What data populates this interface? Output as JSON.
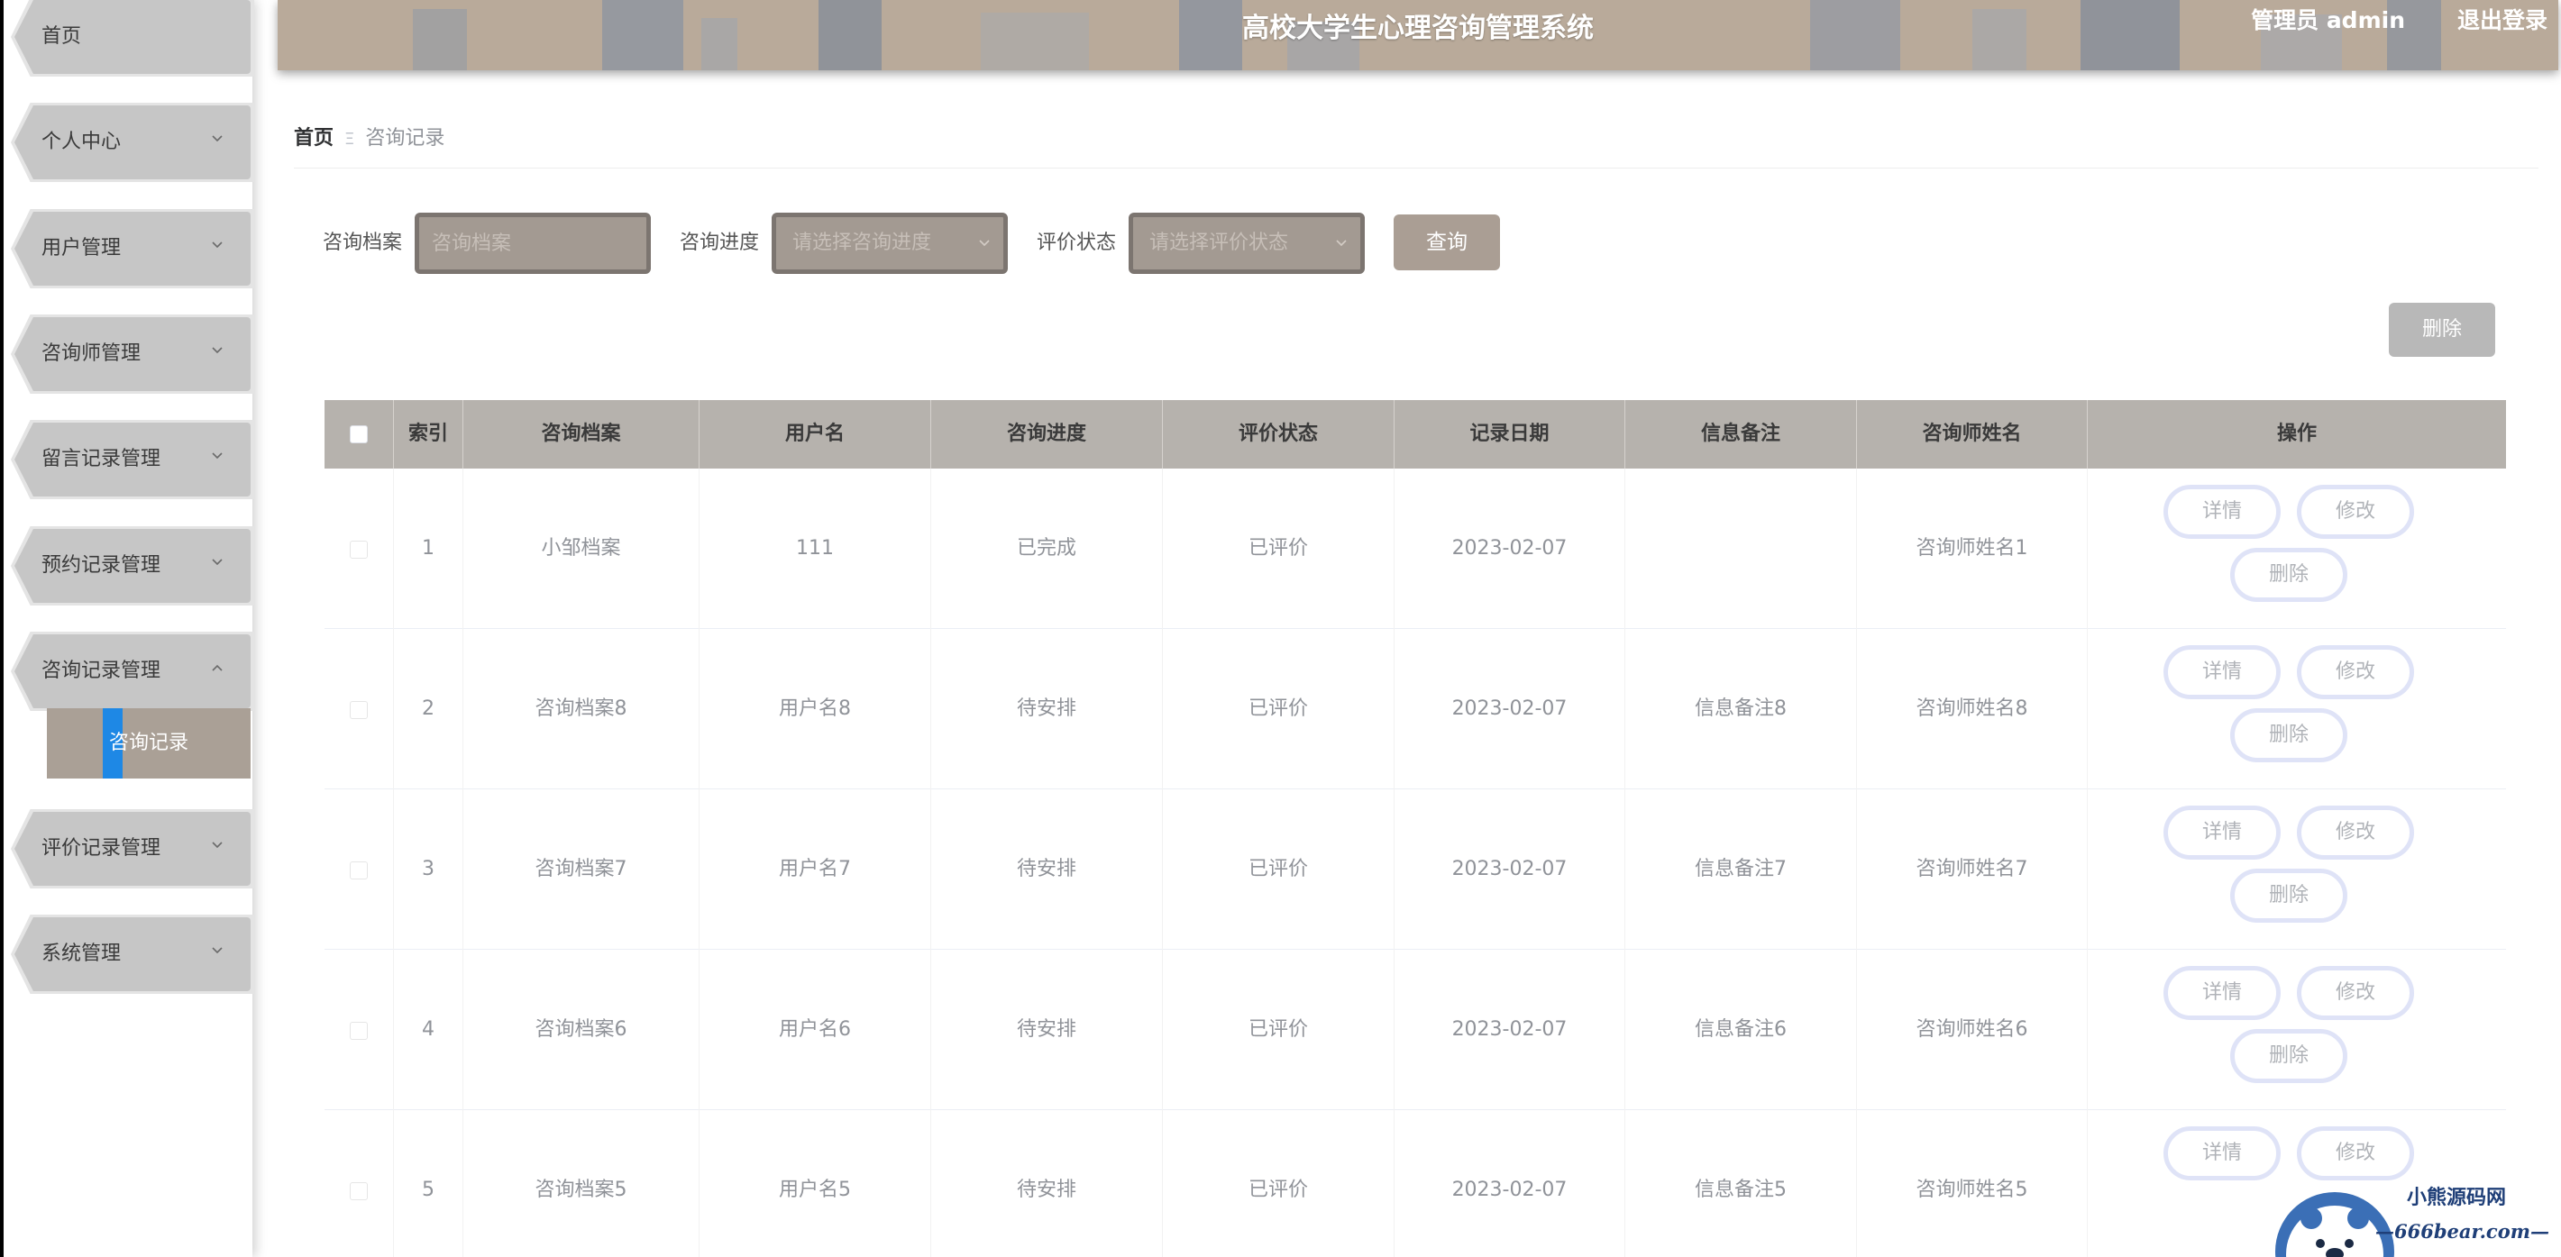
{
  "header": {
    "title": "高校大学生心理咨询管理系统",
    "user": "管理员 admin",
    "logout": "退出登录"
  },
  "sidebar": {
    "items": [
      {
        "label": "首页",
        "has_chevron": false
      },
      {
        "label": "个人中心",
        "has_chevron": true
      },
      {
        "label": "用户管理",
        "has_chevron": true
      },
      {
        "label": "咨询师管理",
        "has_chevron": true
      },
      {
        "label": "留言记录管理",
        "has_chevron": true
      },
      {
        "label": "预约记录管理",
        "has_chevron": true
      },
      {
        "label": "咨询记录管理",
        "has_chevron": true,
        "expanded": true
      },
      {
        "label": "评价记录管理",
        "has_chevron": true
      },
      {
        "label": "系统管理",
        "has_chevron": true
      }
    ],
    "sub_item": "咨询记录"
  },
  "breadcrumb": {
    "home": "首页",
    "separator": "Ξ",
    "current": "咨询记录"
  },
  "search": {
    "archive_label": "咨询档案",
    "archive_placeholder": "咨询档案",
    "progress_label": "咨询进度",
    "progress_placeholder": "请选择咨询进度",
    "status_label": "评价状态",
    "status_placeholder": "请选择评价状态",
    "query_button": "查询"
  },
  "toolbar": {
    "delete_button": "删除"
  },
  "table": {
    "headers": [
      "索引",
      "咨询档案",
      "用户名",
      "咨询进度",
      "评价状态",
      "记录日期",
      "信息备注",
      "咨询师姓名",
      "操作"
    ],
    "rows": [
      {
        "index": "1",
        "archive": "小邹档案",
        "username": "111",
        "progress": "已完成",
        "status": "已评价",
        "date": "2023-02-07",
        "note": "",
        "counselor": "咨询师姓名1"
      },
      {
        "index": "2",
        "archive": "咨询档案8",
        "username": "用户名8",
        "progress": "待安排",
        "status": "已评价",
        "date": "2023-02-07",
        "note": "信息备注8",
        "counselor": "咨询师姓名8"
      },
      {
        "index": "3",
        "archive": "咨询档案7",
        "username": "用户名7",
        "progress": "待安排",
        "status": "已评价",
        "date": "2023-02-07",
        "note": "信息备注7",
        "counselor": "咨询师姓名7"
      },
      {
        "index": "4",
        "archive": "咨询档案6",
        "username": "用户名6",
        "progress": "待安排",
        "status": "已评价",
        "date": "2023-02-07",
        "note": "信息备注6",
        "counselor": "咨询师姓名6"
      },
      {
        "index": "5",
        "archive": "咨询档案5",
        "username": "用户名5",
        "progress": "待安排",
        "status": "已评价",
        "date": "2023-02-07",
        "note": "信息备注5",
        "counselor": "咨询师姓名5"
      }
    ],
    "actions": {
      "detail": "详情",
      "edit": "修改",
      "delete": "删除"
    }
  },
  "watermark": {
    "line1": "小熊源码网",
    "line2": "—666bear.com—"
  },
  "colors": {
    "header_bg": "#b9aa9a",
    "sidebar_tab": "#c6c6c6",
    "active_sub": "#aaa096",
    "active_marker": "#1e88e5",
    "table_head": "#b6b2ad",
    "button_bg": "#aa9e94"
  }
}
